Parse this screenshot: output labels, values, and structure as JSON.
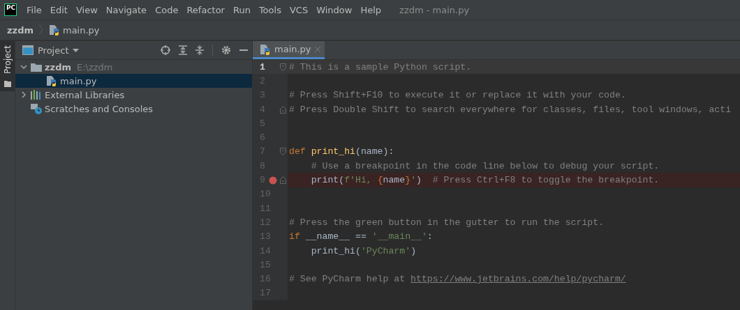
{
  "menu_bar": {
    "logo": "PC",
    "items": [
      "File",
      "Edit",
      "View",
      "Navigate",
      "Code",
      "Refactor",
      "Run",
      "Tools",
      "VCS",
      "Window",
      "Help"
    ],
    "title": "zzdm - main.py"
  },
  "breadcrumb": [
    {
      "label": "zzdm",
      "kind": "folder"
    },
    {
      "label": "main.py",
      "kind": "python"
    }
  ],
  "side_stripe": {
    "label": "Project"
  },
  "project_panel": {
    "title": "Project",
    "tree": [
      {
        "label": "zzdm",
        "detail": "E:\\zzdm",
        "kind": "folder",
        "expanded": true,
        "selected": false,
        "children": [
          {
            "label": "main.py",
            "kind": "python",
            "selected": true
          }
        ]
      },
      {
        "label": "External Libraries",
        "kind": "libraries",
        "expanded": false,
        "selected": false
      },
      {
        "label": "Scratches and Consoles",
        "kind": "scratches",
        "selected": false
      }
    ]
  },
  "editor": {
    "tabs": [
      {
        "label": "main.py",
        "selected": true
      }
    ],
    "lines": [
      {
        "number": "1",
        "current": true,
        "breakpoint": false,
        "fold_start": true,
        "tokens": [
          {
            "kind": "comment",
            "text": "# This is a sample Python script."
          }
        ]
      },
      {
        "number": "2",
        "current": false,
        "breakpoint": false
      },
      {
        "number": "3",
        "current": false,
        "breakpoint": false,
        "tokens": [
          {
            "kind": "comment",
            "text": "# Press Shift+F10 to execute it or replace it with your code."
          }
        ]
      },
      {
        "number": "4",
        "current": false,
        "breakpoint": false,
        "fold_end": true,
        "tokens": [
          {
            "kind": "comment",
            "text": "# Press Double Shift to search everywhere for classes, files, tool windows, acti"
          }
        ]
      },
      {
        "number": "5",
        "current": false,
        "breakpoint": false
      },
      {
        "number": "6",
        "current": false,
        "breakpoint": false
      },
      {
        "number": "7",
        "current": false,
        "breakpoint": false,
        "fold_start": true,
        "tokens": [
          {
            "kind": "keyword",
            "text": "def "
          },
          {
            "kind": "function",
            "text": "print_hi"
          },
          {
            "kind": "plain",
            "text": "(name):"
          }
        ]
      },
      {
        "number": "8",
        "current": false,
        "breakpoint": false,
        "tokens": [
          {
            "kind": "comment",
            "text": "    # Use a breakpoint in the code line below to debug your script."
          }
        ]
      },
      {
        "number": "9",
        "current": false,
        "breakpoint": true,
        "fold_end": true,
        "tokens": [
          {
            "kind": "plain",
            "text": "    print("
          },
          {
            "kind": "string",
            "text": "f'Hi, "
          },
          {
            "kind": "keyword",
            "text": "{"
          },
          {
            "kind": "plain",
            "text": "name"
          },
          {
            "kind": "keyword",
            "text": "}"
          },
          {
            "kind": "string",
            "text": "'"
          },
          {
            "kind": "plain",
            "text": ")  "
          },
          {
            "kind": "comment",
            "text": "# Press Ctrl+F8 to toggle the breakpoint."
          }
        ]
      },
      {
        "number": "10",
        "current": false,
        "breakpoint": false
      },
      {
        "number": "11",
        "current": false,
        "breakpoint": false
      },
      {
        "number": "12",
        "current": false,
        "breakpoint": false,
        "tokens": [
          {
            "kind": "comment",
            "text": "# Press the green button in the gutter to run the script."
          }
        ]
      },
      {
        "number": "13",
        "current": false,
        "breakpoint": false,
        "tokens": [
          {
            "kind": "keyword",
            "text": "if "
          },
          {
            "kind": "plain",
            "text": "__name__ == "
          },
          {
            "kind": "string",
            "text": "'__main__'"
          },
          {
            "kind": "plain",
            "text": ":"
          }
        ]
      },
      {
        "number": "14",
        "current": false,
        "breakpoint": false,
        "tokens": [
          {
            "kind": "plain",
            "text": "    print_hi("
          },
          {
            "kind": "string",
            "text": "'PyCharm'"
          },
          {
            "kind": "plain",
            "text": ")"
          }
        ]
      },
      {
        "number": "15",
        "current": false,
        "breakpoint": false
      },
      {
        "number": "16",
        "current": false,
        "breakpoint": false,
        "tokens": [
          {
            "kind": "comment",
            "text": "# See PyCharm help at "
          },
          {
            "kind": "link",
            "text": "https://www.jetbrains.com/help/pycharm/"
          }
        ]
      },
      {
        "number": "17",
        "current": false,
        "breakpoint": false
      }
    ]
  }
}
